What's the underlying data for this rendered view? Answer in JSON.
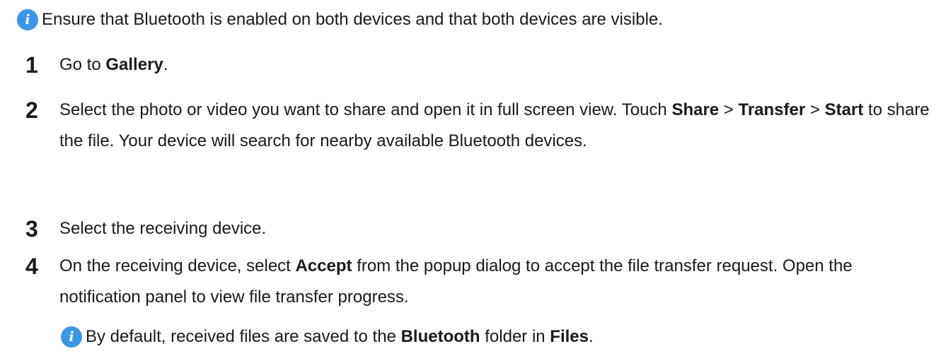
{
  "note_top": {
    "icon": "info-icon",
    "text": "Ensure that Bluetooth is enabled on both devices and that both devices are visible."
  },
  "steps": [
    {
      "number": "1",
      "parts": [
        "Go to ",
        "Gallery",
        "."
      ]
    },
    {
      "number": "2",
      "parts": [
        "Select the photo or video you want to share and open it in full screen view. Touch ",
        "Share",
        " > ",
        "Transfer",
        " > ",
        "Start",
        " to share the file. Your device will search for nearby available Bluetooth devices."
      ]
    },
    {
      "number": "3",
      "parts": [
        "Select the receiving device."
      ]
    },
    {
      "number": "4",
      "parts": [
        "On the receiving device, select ",
        "Accept",
        " from the popup dialog to accept the file transfer request. Open the notification panel to view file transfer progress."
      ]
    }
  ],
  "note_bottom": {
    "icon": "info-icon",
    "parts": [
      "By default, received files are saved to the ",
      "Bluetooth",
      " folder in ",
      "Files",
      "."
    ]
  },
  "colors": {
    "info_icon": "#3c96e6",
    "text": "#1a1a1a"
  }
}
